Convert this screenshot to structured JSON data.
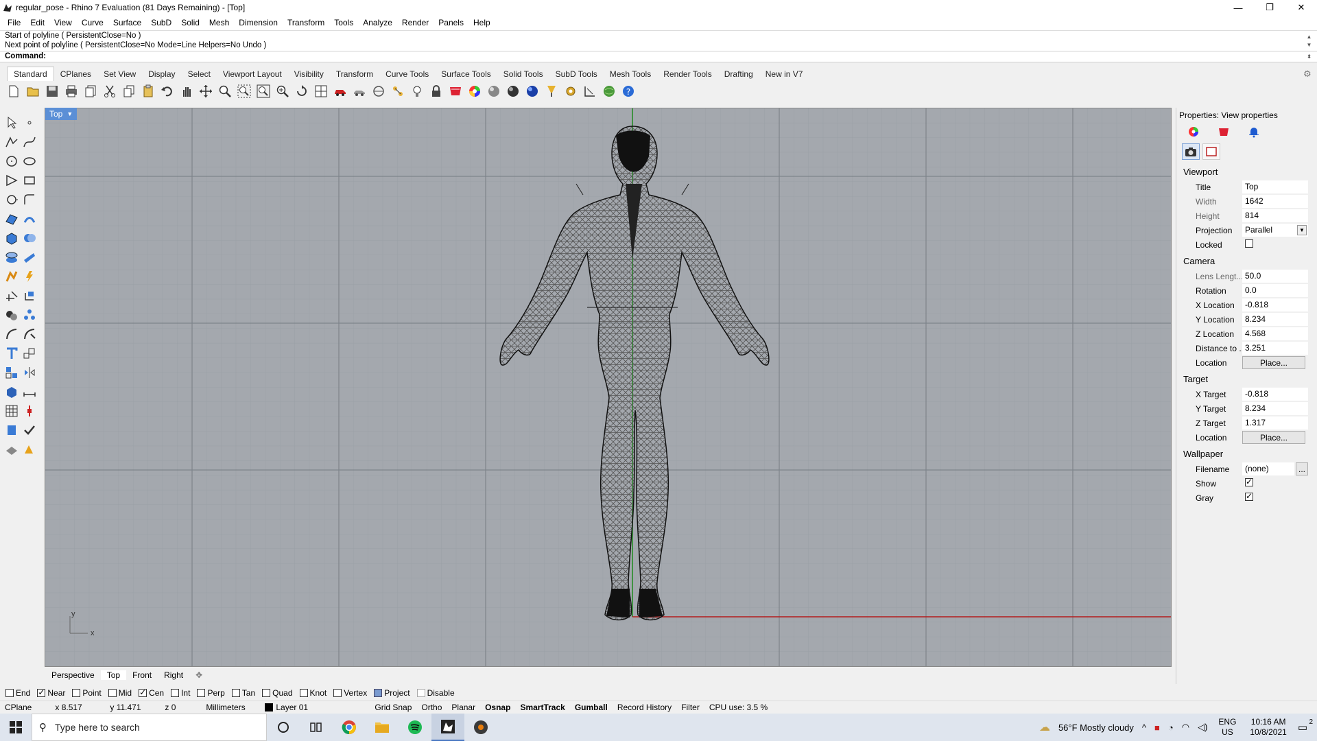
{
  "window": {
    "title": "regular_pose - Rhino 7 Evaluation (81 Days Remaining) - [Top]",
    "minimize": "—",
    "maximize": "❐",
    "close": "✕"
  },
  "menu": [
    "File",
    "Edit",
    "View",
    "Curve",
    "Surface",
    "SubD",
    "Solid",
    "Mesh",
    "Dimension",
    "Transform",
    "Tools",
    "Analyze",
    "Render",
    "Panels",
    "Help"
  ],
  "command": {
    "history": [
      "Start of polyline ( PersistentClose=No )",
      "Next point of polyline ( PersistentClose=No  Mode=Line  Helpers=No  Undo )"
    ],
    "prompt": "Command:"
  },
  "toolbar_tabs": [
    "Standard",
    "CPlanes",
    "Set View",
    "Display",
    "Select",
    "Viewport Layout",
    "Visibility",
    "Transform",
    "Curve Tools",
    "Surface Tools",
    "Solid Tools",
    "SubD Tools",
    "Mesh Tools",
    "Render Tools",
    "Drafting",
    "New in V7"
  ],
  "toolbar_icons": [
    "new-icon",
    "open-icon",
    "save-icon",
    "print-icon",
    "import-icon",
    "cut-icon",
    "copy-icon",
    "paste-icon",
    "undo-icon",
    "pan-icon",
    "move-view-icon",
    "zoom-window-icon",
    "zoom-extents-icon",
    "zoom-selected-icon",
    "zoom-icon",
    "rotate-view-icon",
    "four-view-icon",
    "car-icon",
    "car-top-icon",
    "circle-icon",
    "snap-icon",
    "bulb-icon",
    "lock-icon",
    "material-icon",
    "color-wheel-icon",
    "sphere-gray-icon",
    "sphere-dark-icon",
    "sphere-blue-icon",
    "paint-icon",
    "gear-tool-icon",
    "dimension-icon",
    "globe-icon",
    "help-icon"
  ],
  "viewport": {
    "name": "Top",
    "axis_x": "x",
    "axis_y": "y"
  },
  "view_tabs": [
    "Perspective",
    "Top",
    "Front",
    "Right"
  ],
  "osnaps": [
    {
      "label": "End",
      "on": false
    },
    {
      "label": "Near",
      "on": true
    },
    {
      "label": "Point",
      "on": false
    },
    {
      "label": "Mid",
      "on": false
    },
    {
      "label": "Cen",
      "on": true
    },
    {
      "label": "Int",
      "on": false
    },
    {
      "label": "Perp",
      "on": false
    },
    {
      "label": "Tan",
      "on": false
    },
    {
      "label": "Quad",
      "on": false
    },
    {
      "label": "Knot",
      "on": false
    },
    {
      "label": "Vertex",
      "on": false
    },
    {
      "label": "Project",
      "on": "filled"
    },
    {
      "label": "Disable",
      "on": false
    }
  ],
  "status": {
    "cplane": "CPlane",
    "x": "x 8.517",
    "y": "y 11.471",
    "z": "z 0",
    "units": "Millimeters",
    "layer": "Layer 01",
    "grid_snap": "Grid Snap",
    "ortho": "Ortho",
    "planar": "Planar",
    "osnap": "Osnap",
    "smarttrack": "SmartTrack",
    "gumball": "Gumball",
    "record_history": "Record History",
    "filter": "Filter",
    "cpu": "CPU use: 3.5 %"
  },
  "properties": {
    "header": "Properties: View properties",
    "sections": {
      "viewport": "Viewport",
      "camera": "Camera",
      "target": "Target",
      "wallpaper": "Wallpaper"
    },
    "viewport_rows": [
      {
        "label": "Title",
        "value": "Top"
      },
      {
        "label": "Width",
        "value": "1642"
      },
      {
        "label": "Height",
        "value": "814"
      },
      {
        "label": "Projection",
        "value": "Parallel"
      },
      {
        "label": "Locked",
        "value": ""
      }
    ],
    "camera_rows": [
      {
        "label": "Lens Lengt...",
        "value": "50.0"
      },
      {
        "label": "Rotation",
        "value": "0.0"
      },
      {
        "label": "X Location",
        "value": "-0.818"
      },
      {
        "label": "Y Location",
        "value": "8.234"
      },
      {
        "label": "Z Location",
        "value": "4.568"
      },
      {
        "label": "Distance to ...",
        "value": "3.251"
      },
      {
        "label": "Location",
        "value": "Place..."
      }
    ],
    "target_rows": [
      {
        "label": "X Target",
        "value": "-0.818"
      },
      {
        "label": "Y Target",
        "value": "8.234"
      },
      {
        "label": "Z Target",
        "value": "1.317"
      },
      {
        "label": "Location",
        "value": "Place..."
      }
    ],
    "wallpaper_rows": [
      {
        "label": "Filename",
        "value": "(none)"
      },
      {
        "label": "Show",
        "value": ""
      },
      {
        "label": "Gray",
        "value": ""
      }
    ],
    "browse": "..."
  },
  "taskbar": {
    "search_placeholder": "Type here to search",
    "weather": "56°F  Mostly cloudy",
    "lang": "ENG",
    "region": "US",
    "time": "10:16 AM",
    "date": "10/8/2021",
    "notif_count": "2"
  }
}
